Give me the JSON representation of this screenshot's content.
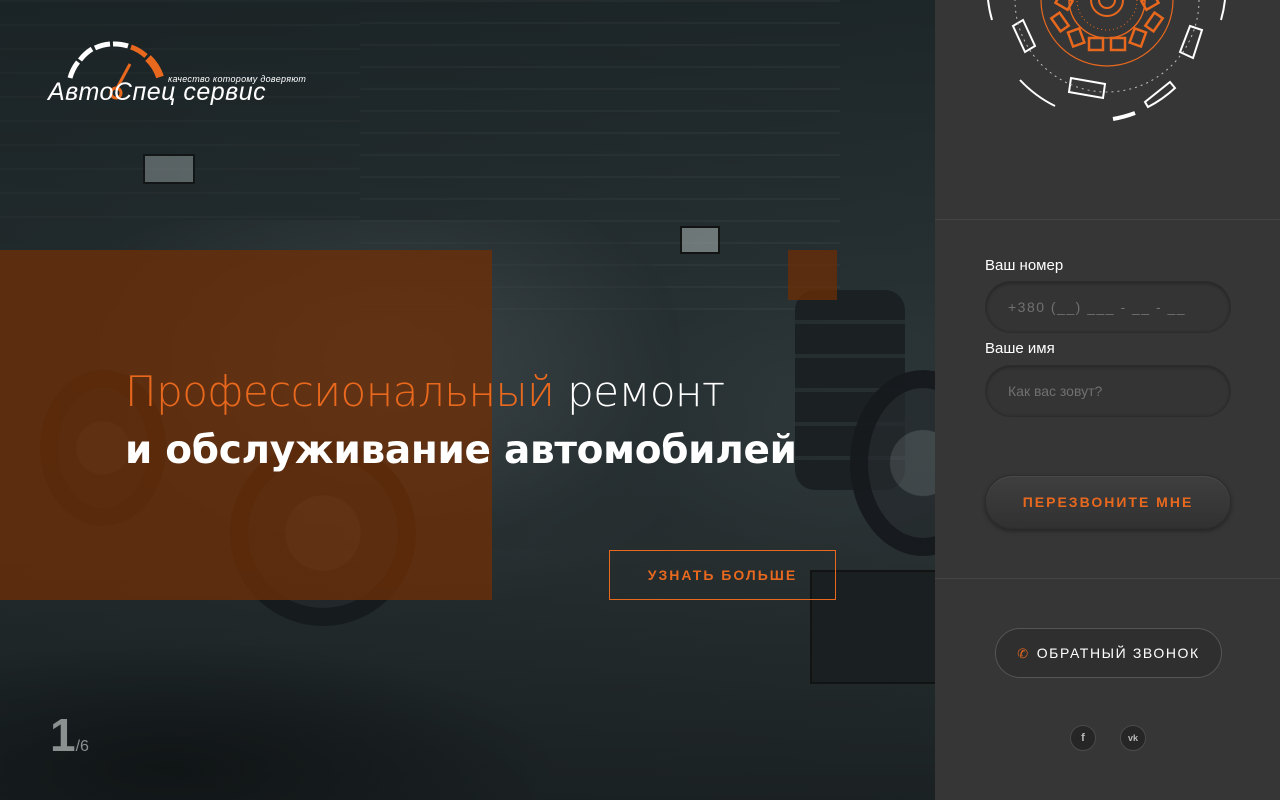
{
  "logo": {
    "tagline": "качество которому доверяют",
    "name": "АвтоСпец сервис"
  },
  "hero": {
    "title_accent": "Профессиональный",
    "title_rest": " ремонт",
    "title_line2": "и обслуживание автомобилей",
    "cta_label": "УЗНАТЬ БОЛЬШЕ"
  },
  "slider": {
    "current": "1",
    "total": "/6"
  },
  "form": {
    "phone_label": "Ваш номер",
    "phone_placeholder": "+380 (__) ___ - __ - __",
    "name_label": "Ваше имя",
    "name_placeholder": "Как вас зовут?",
    "submit_label": "ПЕРЕЗВОНИТЕ МНЕ"
  },
  "callback": {
    "label": "ОБРАТНЫЙ ЗВОНОК",
    "icon": "phone-icon"
  },
  "social": {
    "facebook_glyph": "f",
    "vk_glyph": "vk"
  },
  "colors": {
    "accent": "#e8681e",
    "sidebar_bg": "#363636",
    "overlay": "#6d2e06"
  }
}
